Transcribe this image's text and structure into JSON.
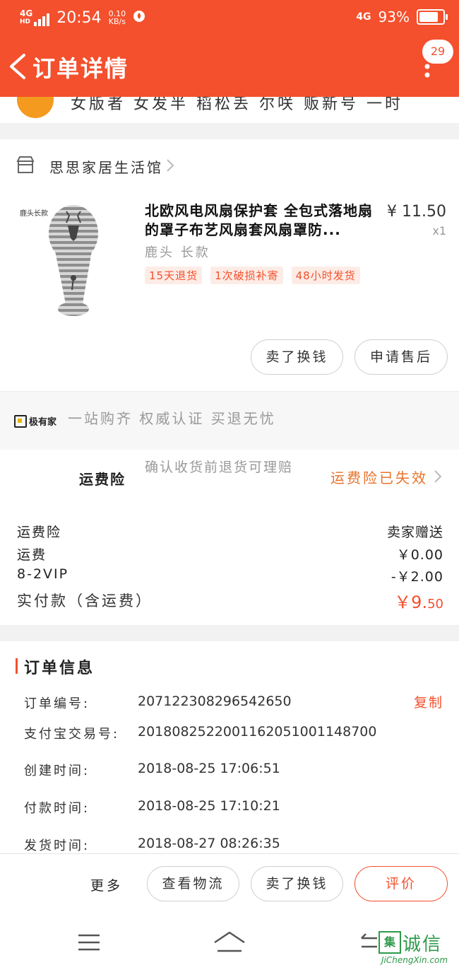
{
  "status_bar": {
    "network": "4G",
    "network_sub": "HD",
    "time": "20:54",
    "speed_value": "0.10",
    "speed_unit": "KB/s",
    "net_right": "4G",
    "battery": "93%",
    "battery_level": 0.93
  },
  "header": {
    "title": "订单详情",
    "badge_count": "29",
    "colors": {
      "brand": "#f4502d"
    }
  },
  "top_strip": {
    "partial_text": "女版者 女发半 稻松丢 尔咲 贩新号 一时"
  },
  "store": {
    "name": "思思家居生活馆"
  },
  "product": {
    "image_label": "鹿头长款",
    "title": "北欧风电风扇保护套 全包式落地扇的罩子布艺风扇套风扇罩防...",
    "price": "¥ 11.50",
    "quantity": "x1",
    "variant": "鹿头 长款",
    "tags": [
      "15天退货",
      "1次破损补寄",
      "48小时发货"
    ],
    "buttons": {
      "sell": "卖了换钱",
      "after_sale": "申请售后"
    }
  },
  "promo": {
    "logo_text": "极有家",
    "text": "一站购齐 权威认证 买退无忧"
  },
  "insurance": {
    "label": "运费险",
    "description": "确认收货前退货可理赔",
    "status": "运费险已失效"
  },
  "costs": {
    "rows": [
      {
        "label": "运费险",
        "value": "卖家赠送"
      },
      {
        "label": "运费",
        "value": "￥0.00"
      },
      {
        "label": "8-2VIP",
        "value": "-￥2.00"
      }
    ],
    "total_label": "实付款（含运费）",
    "total_currency": "￥9.",
    "total_cents": "50"
  },
  "order_info": {
    "title": "订单信息",
    "copy_label": "复制",
    "rows": [
      {
        "key": "订单编号:",
        "value": "207122308296542650"
      },
      {
        "key": "支付宝交易号:",
        "value": "2018082522001162051001148700"
      },
      {
        "key": "创建时间:",
        "value": "2018-08-25 17:06:51"
      },
      {
        "key": "付款时间:",
        "value": "2018-08-25 17:10:21"
      },
      {
        "key": "发货时间:",
        "value": "2018-08-27 08:26:35"
      }
    ]
  },
  "actions": {
    "more": "更多",
    "logistics": "查看物流",
    "sell": "卖了换钱",
    "review": "评价"
  },
  "watermark": {
    "box_char": "集",
    "cn": "诚信",
    "en": "JiChengXin.com"
  }
}
